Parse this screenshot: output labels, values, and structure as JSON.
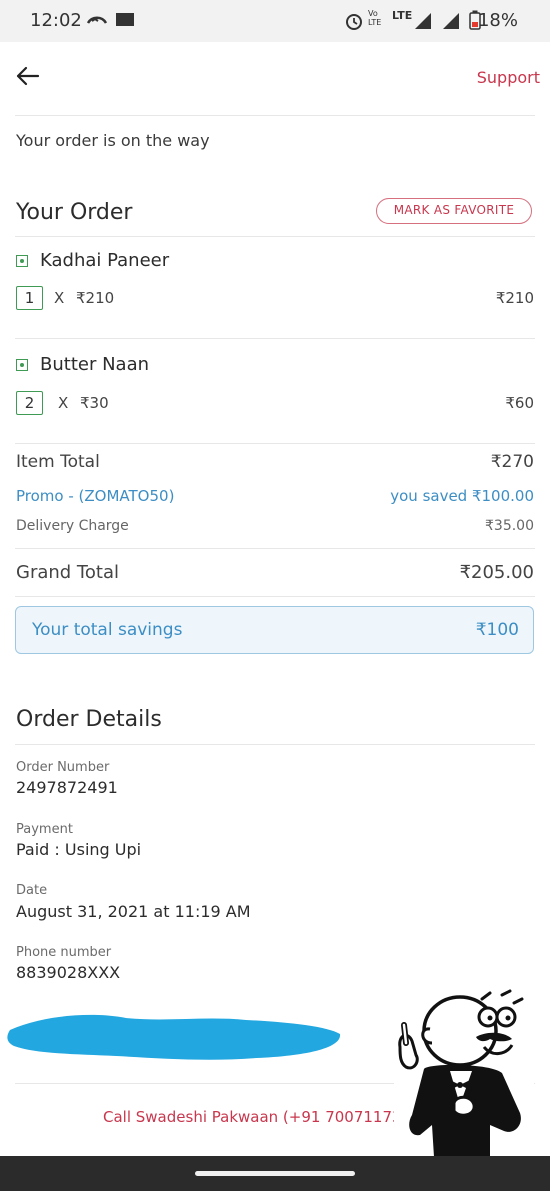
{
  "status_bar": {
    "time": "12:02",
    "battery": "18%",
    "network": "LTE"
  },
  "header": {
    "back_icon": "arrow-left-icon",
    "support_label": "Support"
  },
  "order_status": "Your order is on the way",
  "your_order": {
    "title": "Your Order",
    "favorite_label": "MARK AS FAVORITE",
    "items": [
      {
        "name": "Kadhai Paneer",
        "qty": "1",
        "x": "X",
        "unit_price": "₹210",
        "total": "₹210"
      },
      {
        "name": "Butter Naan",
        "qty": "2",
        "x": "X",
        "unit_price": "₹30",
        "total": "₹60"
      }
    ]
  },
  "bill": {
    "item_total_label": "Item Total",
    "item_total_value": "₹270",
    "promo_label": "Promo - (ZOMATO50)",
    "promo_value": "you saved ₹100.00",
    "delivery_label": "Delivery Charge",
    "delivery_value": "₹35.00",
    "grand_total_label": "Grand Total",
    "grand_total_value": "₹205.00",
    "savings_label": "Your total savings",
    "savings_value": "₹100"
  },
  "order_details": {
    "title": "Order Details",
    "order_number_label": "Order Number",
    "order_number": "2497872491",
    "payment_label": "Payment",
    "payment": "Paid : Using Upi",
    "date_label": "Date",
    "date": "August 31, 2021 at 11:19 AM",
    "phone_label": "Phone number",
    "phone": "8839028XXX"
  },
  "call_label": "Call Swadeshi Pakwaan (+91 70071173",
  "colors": {
    "accent": "#c8374d",
    "promo_blue": "#3d8ec4",
    "veg_green": "#3f9a54",
    "scribble": "#22a7e0"
  }
}
